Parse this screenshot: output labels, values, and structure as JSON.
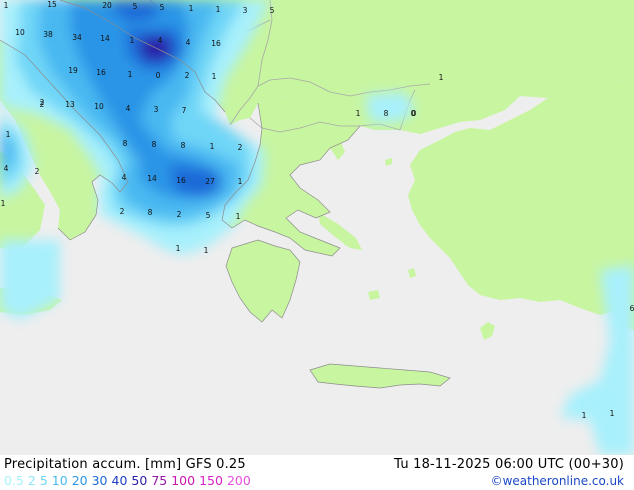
{
  "footer": {
    "title": "Precipitation accum. [mm]  GFS 0.25",
    "datetime": "Tu 18-11-2025 06:00 UTC (00+30)",
    "credit": "©weatheronline.co.uk"
  },
  "legend": [
    {
      "label": "0.5",
      "color": "#a8f0fc"
    },
    {
      "label": "2",
      "color": "#8de6fb"
    },
    {
      "label": "5",
      "color": "#6fd6f7"
    },
    {
      "label": "10",
      "color": "#48b8f1"
    },
    {
      "label": "20",
      "color": "#2c94e6"
    },
    {
      "label": "30",
      "color": "#1c6bd8"
    },
    {
      "label": "40",
      "color": "#1e3fc4"
    },
    {
      "label": "50",
      "color": "#2a1fa8"
    },
    {
      "label": "75",
      "color": "#9616a6"
    },
    {
      "label": "100",
      "color": "#c616b0"
    },
    {
      "label": "150",
      "color": "#d622c8"
    },
    {
      "label": "200",
      "color": "#e84ee0"
    }
  ],
  "colors": {
    "land": "#c8f5a0",
    "sea": "#eeeeee",
    "border": "#a8a8a8",
    "coast": "#8c8c8c"
  },
  "value_labels": [
    "15",
    "20",
    "5",
    "5",
    "1",
    "1",
    "3",
    "5",
    "10",
    "38",
    "34",
    "14",
    "1",
    "4",
    "4",
    "16",
    "19",
    "16",
    "1",
    "0",
    "2",
    "1",
    "1",
    "2",
    "13",
    "10",
    "4",
    "3",
    "7",
    "1",
    "2",
    "4",
    "8",
    "8",
    "8",
    "1",
    "2",
    "4",
    "14",
    "16",
    "27",
    "1",
    "2",
    "8",
    "2",
    "5",
    "1",
    "1",
    "1",
    "1",
    "8",
    "0",
    "1",
    "1",
    "6",
    "1",
    "1",
    "2",
    "0"
  ]
}
